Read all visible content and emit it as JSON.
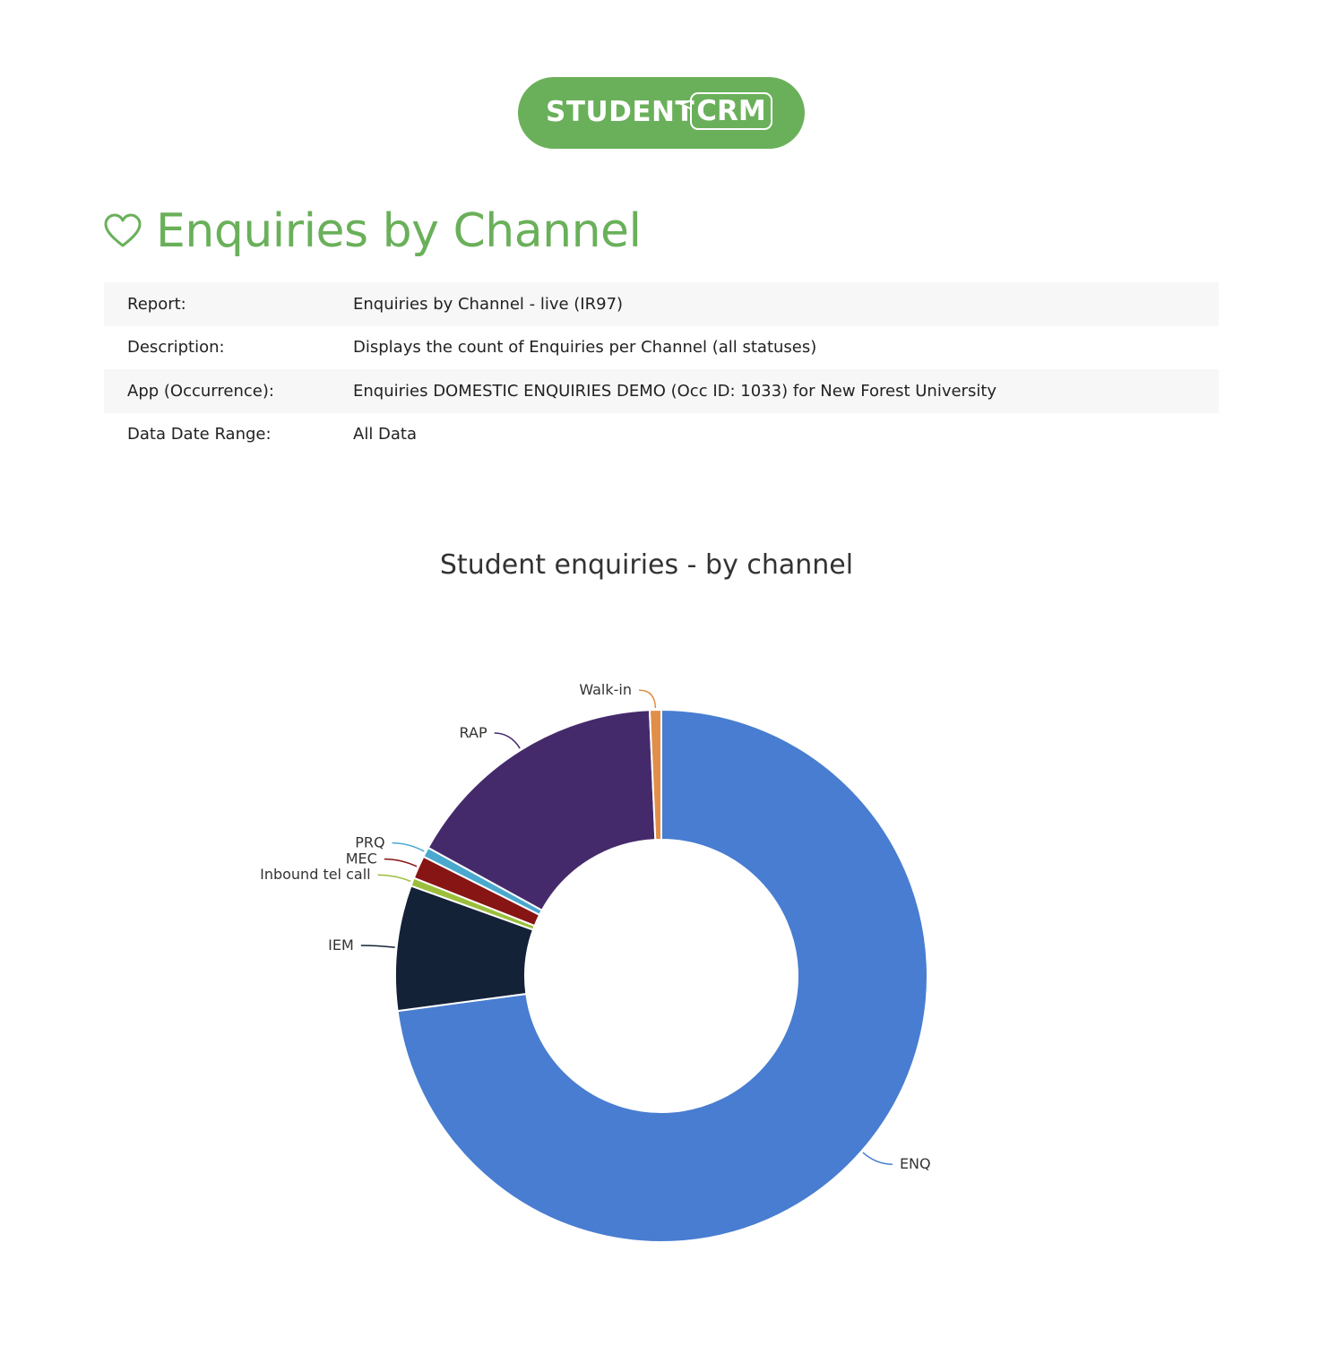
{
  "logo": {
    "word1": "STUDENT",
    "word2": "CRM"
  },
  "page_title": "Enquiries by Channel",
  "info": [
    {
      "key": "Report:",
      "value": "Enquiries by Channel - live (IR97)"
    },
    {
      "key": "Description:",
      "value": "Displays the count of Enquiries per Channel (all statuses)"
    },
    {
      "key": "App (Occurrence):",
      "value": "Enquiries DOMESTIC ENQUIRIES DEMO (Occ ID: 1033) for New Forest University"
    },
    {
      "key": "Data Date Range:",
      "value": "All Data"
    }
  ],
  "chart_data": {
    "type": "pie",
    "donut": true,
    "title": "Student enquiries - by channel",
    "labels": [
      "ENQ",
      "IEM",
      "Inbound tel call",
      "MEC",
      "PRQ",
      "RAP",
      "Walk-in"
    ],
    "values": [
      72.9,
      7.6,
      0.5,
      1.4,
      0.6,
      16.3,
      0.7
    ],
    "colors": [
      "#487dd1",
      "#142238",
      "#9bbf3c",
      "#871513",
      "#4aa8cf",
      "#452a6b",
      "#e08f48"
    ]
  }
}
